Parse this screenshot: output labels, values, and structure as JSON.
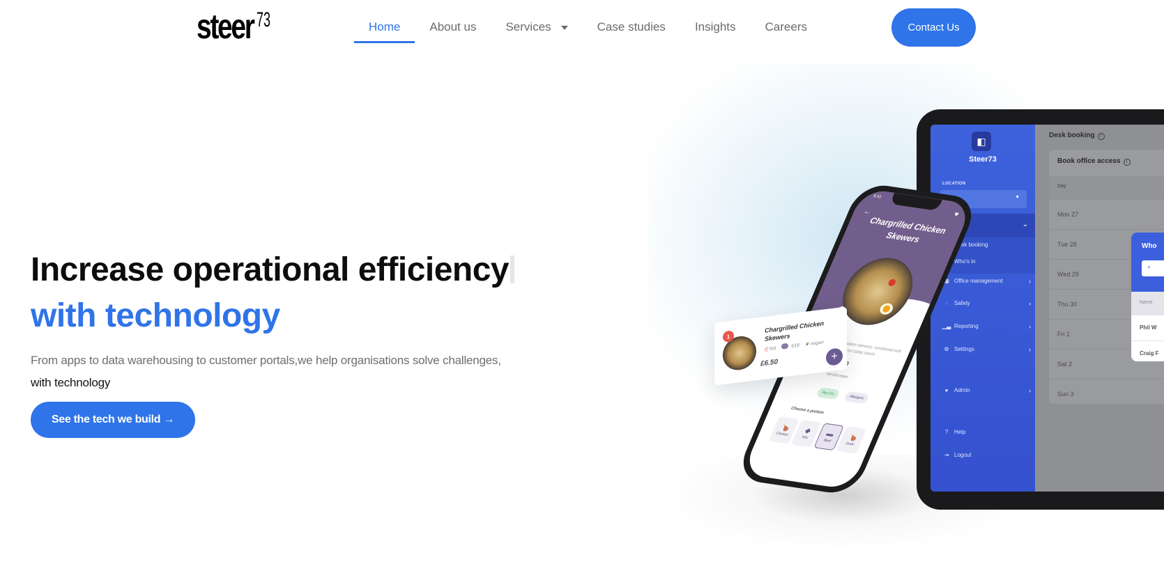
{
  "header": {
    "logo": {
      "word": "steer",
      "number": "73"
    },
    "nav": [
      {
        "label": "Home",
        "active": true
      },
      {
        "label": "About us",
        "active": false
      },
      {
        "label": "Services",
        "active": false,
        "has_dropdown": true
      },
      {
        "label": "Case studies",
        "active": false
      },
      {
        "label": "Insights",
        "active": false
      },
      {
        "label": "Careers",
        "active": false
      }
    ],
    "contact_button": "Contact Us"
  },
  "hero": {
    "title_line1": "Increase operational efficiency",
    "title_line2": "with technology",
    "subtitle": "From apps to data warehousing to customer portals,we help organisations solve challenges,",
    "subtitle_emphasis": "with technology",
    "cta": "See the tech we build →"
  },
  "colors": {
    "accent": "#2f74e8",
    "tablet_sidebar": "#3d62dc",
    "phone_purple": "#725e8c"
  },
  "mockup_tablet": {
    "brand": "Steer73",
    "location_label": "LOCATION",
    "sidebar": [
      {
        "label": "Desk booking",
        "icon": "calendar-icon",
        "sub": true
      },
      {
        "label": "Who's in",
        "icon": "",
        "sub": true
      },
      {
        "label": "Office management",
        "icon": "building-icon"
      },
      {
        "label": "Safety",
        "icon": "shield-icon"
      },
      {
        "label": "Reporting",
        "icon": "chart-icon"
      },
      {
        "label": "Settings",
        "icon": "gear-icon"
      },
      {
        "label": "Admin",
        "icon": "user-icon"
      },
      {
        "label": "Help",
        "icon": "help-icon"
      },
      {
        "label": "Logout",
        "icon": "logout-icon"
      }
    ],
    "page_title": "Desk booking",
    "card_title": "Book office access",
    "column_header": "Day",
    "days": [
      "Mon 27",
      "Tue 28",
      "Wed 29",
      "Thu 30",
      "Fri 1",
      "Sat 2",
      "Sun 3"
    ],
    "popup": {
      "title": "Who",
      "column": "Name",
      "rows": [
        "Phil W",
        "Craig F"
      ]
    }
  },
  "mockup_phone": {
    "time": "9:41",
    "dish_title": "Chargrilled Chicken Skewers",
    "description": "chicken skewers, smothered with peanut satay sauce.",
    "price": "£6.50",
    "tags": [
      "hot",
      "618",
      "vegan"
    ],
    "pills": [
      "2kg CO₂",
      "Allergens"
    ],
    "protein_label": "Choose a protein",
    "proteins": [
      {
        "label": "Chicken",
        "selected": false
      },
      {
        "label": "Tofu",
        "selected": false
      },
      {
        "label": "Beef",
        "selected": true
      },
      {
        "label": "Duck",
        "selected": false
      }
    ]
  },
  "mockup_card": {
    "badge": "1",
    "title": "Chargrilled Chicken Skewers",
    "tags": [
      "hot",
      "618",
      "vegan"
    ],
    "price": "£6.50",
    "add_label": "+"
  }
}
